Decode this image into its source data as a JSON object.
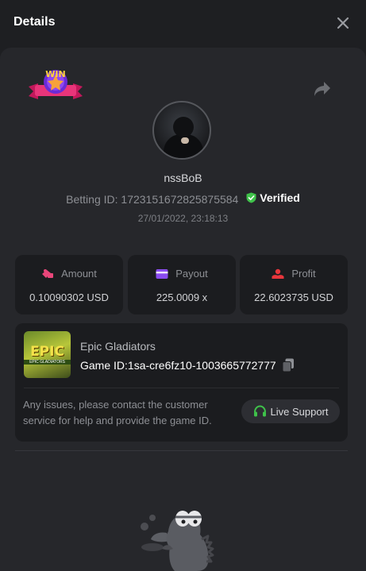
{
  "header": {
    "title": "Details",
    "close_icon": "close-icon"
  },
  "badge": {
    "text": "WIN",
    "icon": "win-badge"
  },
  "share_icon": "share-icon",
  "user": {
    "name": "nssBoB",
    "betting_id_label": "Betting ID: 1723151672825875584",
    "verified_label": "Verified",
    "timestamp": "27/01/2022, 23:18:13"
  },
  "stats": [
    {
      "label": "Amount",
      "value": "0.10090302 USD",
      "icon": "amount-icon",
      "color": "#e9467a"
    },
    {
      "label": "Payout",
      "value": "225.0009 x",
      "icon": "payout-icon",
      "color": "#8a4bf0"
    },
    {
      "label": "Profit",
      "value": "22.6023735 USD",
      "icon": "profit-icon",
      "color": "#e8363c"
    }
  ],
  "game": {
    "name": "Epic Gladiators",
    "id_label": "Game ID:1sa-cre6fz10-1003665772777",
    "thumb_title": "EPIC",
    "thumb_sub": "EPIC GLADIATORS"
  },
  "help_text": "Any issues, please contact the customer service for help and provide the game ID.",
  "support": {
    "label": "Live Support",
    "icon": "headset-icon",
    "color": "#3fc24a"
  },
  "colors": {
    "background": "#1e1f22",
    "panel": "#26272b",
    "card": "#1b1c1f",
    "verified": "#3fc24a"
  }
}
